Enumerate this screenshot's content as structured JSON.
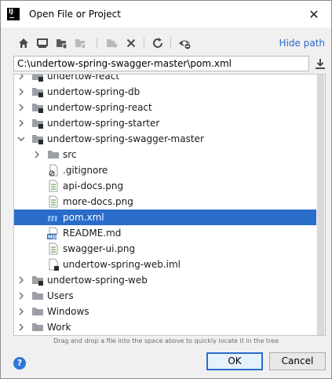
{
  "window": {
    "title": "Open File or Project",
    "close_glyph": "✕",
    "app_icon_text": "IJ"
  },
  "toolbar": {
    "hide_path_label": "Hide path",
    "icons": [
      "home-icon",
      "desktop-icon",
      "project-folder-icon",
      "module-folder-icon",
      "new-folder-icon",
      "delete-icon",
      "refresh-icon",
      "show-hidden-icon"
    ]
  },
  "path": {
    "value": "C:\\undertow-spring-swagger-master\\pom.xml"
  },
  "tree": {
    "rows": [
      {
        "label": "undertow-react",
        "depth": 0,
        "arrow": "right",
        "icon": "module-folder"
      },
      {
        "label": "undertow-spring-db",
        "depth": 0,
        "arrow": "right",
        "icon": "module-folder"
      },
      {
        "label": "undertow-spring-react",
        "depth": 0,
        "arrow": "right",
        "icon": "module-folder"
      },
      {
        "label": "undertow-spring-starter",
        "depth": 0,
        "arrow": "right",
        "icon": "module-folder"
      },
      {
        "label": "undertow-spring-swagger-master",
        "depth": 0,
        "arrow": "down",
        "icon": "module-folder"
      },
      {
        "label": "src",
        "depth": 1,
        "arrow": "right",
        "icon": "folder"
      },
      {
        "label": ".gitignore",
        "depth": 1,
        "arrow": "",
        "icon": "gitignore"
      },
      {
        "label": "api-docs.png",
        "depth": 1,
        "arrow": "",
        "icon": "image"
      },
      {
        "label": "more-docs.png",
        "depth": 1,
        "arrow": "",
        "icon": "image"
      },
      {
        "label": "pom.xml",
        "depth": 1,
        "arrow": "",
        "icon": "maven",
        "selected": true
      },
      {
        "label": "README.md",
        "depth": 1,
        "arrow": "",
        "icon": "markdown"
      },
      {
        "label": "swagger-ui.png",
        "depth": 1,
        "arrow": "",
        "icon": "image"
      },
      {
        "label": "undertow-spring-web.iml",
        "depth": 1,
        "arrow": "",
        "icon": "iml"
      },
      {
        "label": "undertow-spring-web",
        "depth": 0,
        "arrow": "right",
        "icon": "module-folder"
      },
      {
        "label": "Users",
        "depth": 0,
        "arrow": "right",
        "icon": "folder"
      },
      {
        "label": "Windows",
        "depth": 0,
        "arrow": "right",
        "icon": "folder"
      },
      {
        "label": "Work",
        "depth": 0,
        "arrow": "right",
        "icon": "folder"
      }
    ]
  },
  "hint": "Drag and drop a file into the space above to quickly locate it in the tree",
  "buttons": {
    "help": "?",
    "ok": "OK",
    "cancel": "Cancel"
  },
  "colors": {
    "selection": "#2a6cc9",
    "link": "#2a6ac8",
    "folder": "#9aa0a6"
  }
}
